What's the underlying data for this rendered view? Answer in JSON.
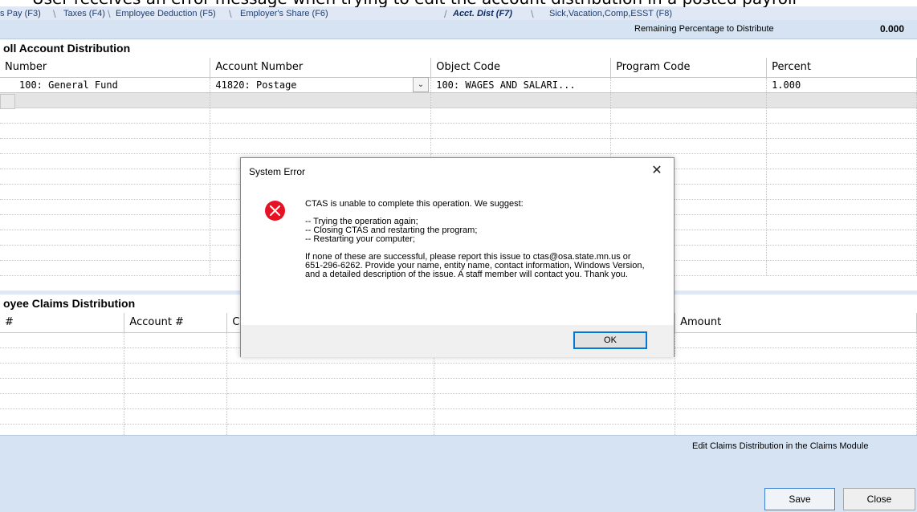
{
  "caption": "User receives an error message when trying to edit the account distribution in a posted payroll",
  "tabs": [
    {
      "label": "s Pay (F3)",
      "active": false
    },
    {
      "label": "Taxes (F4)",
      "active": false
    },
    {
      "label": "Employee Deduction (F5)",
      "active": false
    },
    {
      "label": "Employer's Share (F6)",
      "active": false
    },
    {
      "label": "Acct. Dist (F7)",
      "active": true
    },
    {
      "label": "Sick,Vacation,Comp,ESST (F8)",
      "active": false
    }
  ],
  "remaining": {
    "label": "Remaining Percentage to Distribute",
    "value": "0.000"
  },
  "payroll_section": {
    "title": "oll Account Distribution",
    "columns": [
      "Number",
      "Account Number",
      "Object Code",
      "Program Code",
      "Percent"
    ],
    "rows": [
      [
        "100: General Fund",
        "41820: Postage",
        "100: WAGES AND SALARI...",
        "",
        "1.000"
      ]
    ]
  },
  "claims_section": {
    "title": "oyee Claims Distribution",
    "columns": [
      "#",
      "Account #",
      "C",
      "",
      "Amount"
    ]
  },
  "footer": {
    "note": "Edit Claims Distribution in the Claims Module",
    "save": "Save",
    "close": "Close"
  },
  "dialog": {
    "title": "System Error",
    "close_glyph": "✕",
    "intro": "CTAS is unable to complete this operation.  We suggest:",
    "suggestions": [
      "-- Trying the operation again;",
      "-- Closing CTAS and restarting the program;",
      "-- Restarting your computer;"
    ],
    "report": "If none of these are successful, please report this issue to ctas@osa.state.mn.us or 651-296-6262. Provide your name, entity name, contact information, Windows Version, and a detailed description of the issue.  A staff member will contact you.  Thank you.",
    "ok": "OK"
  },
  "colors": {
    "error_red": "#e81123",
    "panel_blue": "#d5e3f3",
    "focus_blue": "#0078d7"
  },
  "icons": {
    "error": "error-x-icon",
    "dropdown": "chevron-down-icon"
  }
}
